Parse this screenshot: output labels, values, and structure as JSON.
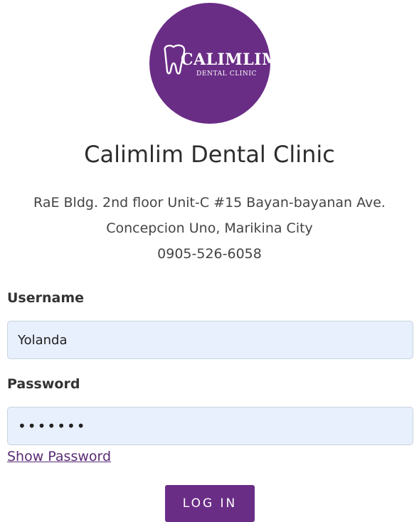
{
  "logo": {
    "wordmark": "CALIMLIM",
    "subtitle": "DENTAL CLINIC",
    "brand_color": "#6a2d86",
    "icon": "tooth-icon"
  },
  "clinic": {
    "name": "Calimlim Dental Clinic",
    "address_line_1": "RaE Bldg. 2nd floor Unit-C #15 Bayan-bayanan Ave.",
    "address_line_2": "Concepcion Uno, Marikina City",
    "phone": "0905-526-6058"
  },
  "form": {
    "username_label": "Username",
    "username_value": "Yolanda",
    "password_label": "Password",
    "password_value": "1234567",
    "show_password_label": "Show Password",
    "login_label": "LOG IN",
    "field_background": "#e8f0fe"
  }
}
